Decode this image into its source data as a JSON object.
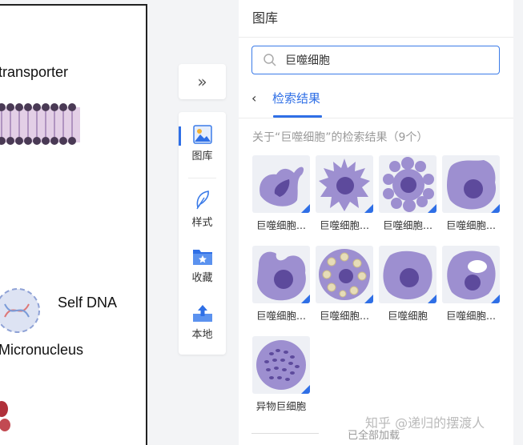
{
  "canvas": {
    "transporter_label": "transporter",
    "self_dna_label": "Self DNA",
    "micronucleus_label": "Micronucleus"
  },
  "toolbar": {
    "collapse_icon": "double-chevron-right-icon",
    "items": [
      {
        "label": "图库",
        "icon": "gallery-icon",
        "active": true
      },
      {
        "label": "样式",
        "icon": "feather-icon",
        "active": false
      },
      {
        "label": "收藏",
        "icon": "folder-star-icon",
        "active": false
      },
      {
        "label": "本地",
        "icon": "upload-icon",
        "active": false
      }
    ]
  },
  "panel": {
    "title": "图库",
    "search": {
      "value": "巨噬细胞",
      "icon": "search-icon"
    },
    "back": {
      "icon": "chevron-left-icon",
      "label": "检索结果"
    },
    "caption": "关于“巨噬细胞”的检索结果（9个）",
    "results": [
      {
        "label": "巨噬细胞...",
        "variant": "a"
      },
      {
        "label": "巨噬细胞...",
        "variant": "b"
      },
      {
        "label": "巨噬细胞...",
        "variant": "c"
      },
      {
        "label": "巨噬细胞...",
        "variant": "d"
      },
      {
        "label": "巨噬细胞...",
        "variant": "e"
      },
      {
        "label": "巨噬细胞...",
        "variant": "f"
      },
      {
        "label": "巨噬细胞",
        "variant": "g"
      },
      {
        "label": "巨噬细胞...",
        "variant": "h"
      },
      {
        "label": "异物巨细胞",
        "variant": "i"
      }
    ],
    "loaded_text": "已全部加载"
  },
  "watermark": "知乎 @递归的摆渡人",
  "colors": {
    "accent": "#2f6fe6",
    "cell_body": "#9d8fd0",
    "nucleus": "#5d4a9c"
  }
}
